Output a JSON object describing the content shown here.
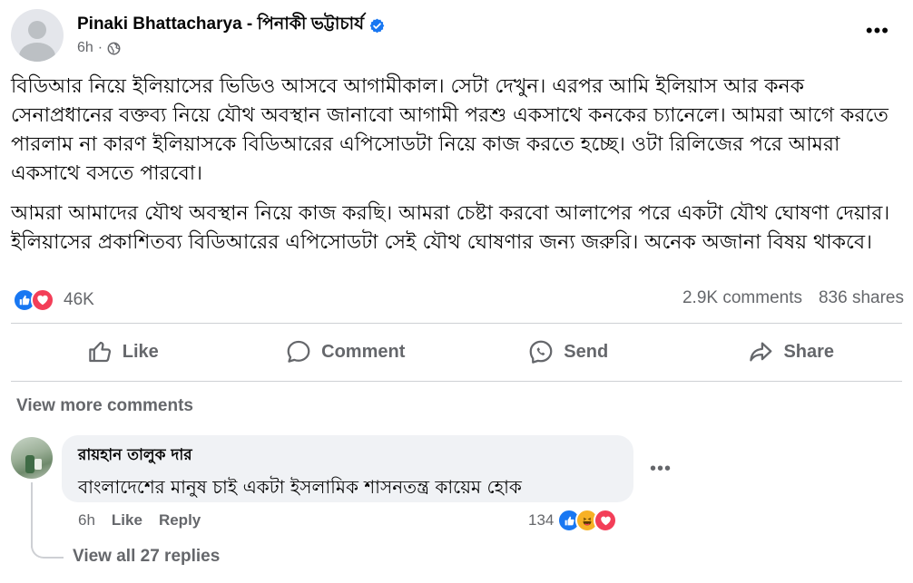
{
  "post": {
    "author": "Pinaki Bhattacharya - পিনাকী ভট্টাচার্য",
    "time": "6h",
    "separator": "·",
    "paragraphs": [
      "বিডিআর নিয়ে ইলিয়াসের ভিডিও আসবে আগামীকাল। সেটা দেখুন। এরপর আমি ইলিয়াস আর কনক সেনাপ্রধানের বক্তব্য নিয়ে যৌথ অবস্থান জানাবো আগামী পরশু একসাথে কনকের চ্যানেলে। আমরা আগে করতে পারলাম না কারণ ইলিয়াসকে বিডিআরের এপিসোডটা নিয়ে কাজ করতে হচ্ছে। ওটা রিলিজের পরে আমরা একসাথে বসতে পারবো।",
      "আমরা আমাদের যৌথ অবস্থান নিয়ে কাজ করছি। আমরা চেষ্টা করবো আলাপের পরে একটা যৌথ ঘোষণা দেয়ার। ইলিয়াসের প্রকাশিতব্য বিডিআরের এপিসোডটা সেই যৌথ ঘোষণার জন্য জরুরি। অনেক অজানা বিষয় থাকবে।"
    ]
  },
  "stats": {
    "reactions": "46K",
    "comments": "2.9K comments",
    "shares": "836 shares"
  },
  "actions": {
    "like": "Like",
    "comment": "Comment",
    "send": "Send",
    "share": "Share"
  },
  "comments_section": {
    "view_more": "View more comments",
    "comment": {
      "author": "রায়হান তালুক দার",
      "text": "বাংলাদেশের মানুষ চাই একটা ইসলামিক শাসনতন্ত্র কায়েম হোক",
      "time": "6h",
      "like": "Like",
      "reply": "Reply",
      "reaction_count": "134"
    },
    "view_replies": "View all 27 replies"
  },
  "colors": {
    "like_blue": "#1877f2",
    "love_red": "#f33e58",
    "haha_yellow": "#f7b125",
    "muted_text": "#65676b",
    "bubble_bg": "#f0f2f5"
  },
  "icons": [
    "verified-badge-icon",
    "globe-icon",
    "more-icon",
    "like-icon",
    "comment-icon",
    "send-icon",
    "share-icon",
    "love-icon",
    "haha-icon"
  ]
}
